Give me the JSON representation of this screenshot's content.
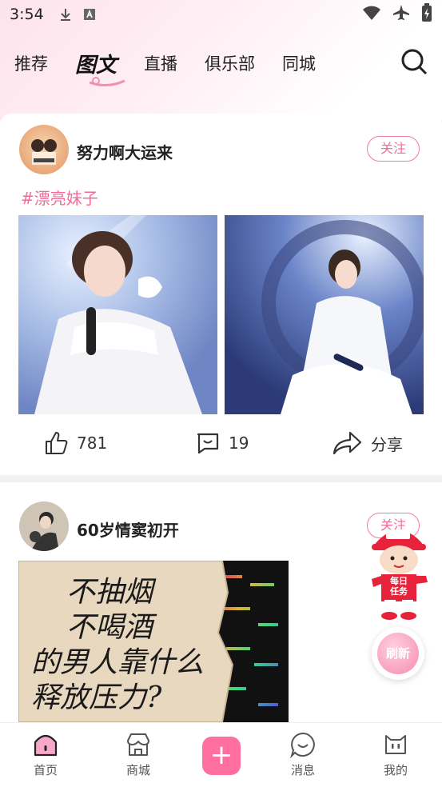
{
  "status_bar": {
    "time": "3:54",
    "icons": [
      "download-icon",
      "font-a-icon",
      "wifi-icon",
      "airplane-icon",
      "battery-charging-icon"
    ]
  },
  "tabs": [
    {
      "label": "推荐",
      "active": false
    },
    {
      "label": "图文",
      "active": true
    },
    {
      "label": "直播",
      "active": false
    },
    {
      "label": "俱乐部",
      "active": false
    },
    {
      "label": "同城",
      "active": false
    }
  ],
  "search": {
    "icon": "search-icon"
  },
  "posts": [
    {
      "username": "努力啊大运来",
      "follow_label": "关注",
      "tag": "#漂亮妹子",
      "images": [
        "singer-photo-left",
        "singer-photo-right"
      ],
      "likes": "781",
      "comments": "19",
      "share_label": "分享"
    },
    {
      "username": "60岁情窦初开",
      "follow_label": "关注",
      "image_text": [
        "不抽烟",
        "不喝酒",
        "的男人靠什么",
        "释放压力?"
      ]
    }
  ],
  "floating": {
    "mascot_badge_line1": "每日",
    "mascot_badge_line2": "任务",
    "refresh_label": "刷新"
  },
  "bottom_nav": [
    {
      "label": "首页",
      "icon": "home-icon",
      "active": true
    },
    {
      "label": "商城",
      "icon": "shop-icon",
      "active": false
    },
    {
      "label": "",
      "icon": "plus-icon",
      "active": false
    },
    {
      "label": "消息",
      "icon": "message-icon",
      "active": false
    },
    {
      "label": "我的",
      "icon": "profile-icon",
      "active": false
    }
  ],
  "colors": {
    "accent": "#ff6fa0",
    "follow_border": "#f27aa3",
    "tag": "#ef6c9a"
  }
}
